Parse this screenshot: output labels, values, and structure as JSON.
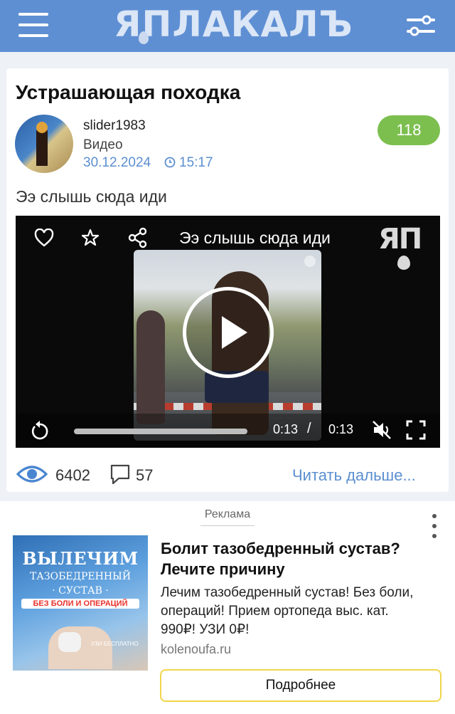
{
  "header": {
    "logo_text": "ЯПЛАКАЛЪ",
    "menu_icon": "hamburger-menu-icon",
    "settings_icon": "filter-sliders-icon",
    "background": "#5f8fd3"
  },
  "post": {
    "title": "Устрашающая походка",
    "author": "slider1983",
    "category": "Видео",
    "date": "30.12.2024",
    "time": "15:17",
    "rating": "118",
    "text": "Ээ слышь сюда иди",
    "video": {
      "title": "Ээ слышь сюда иди",
      "current_time": "0:13",
      "separator": "/",
      "total_time": "0:13",
      "watermark": "ЯП",
      "progress": 1.0
    },
    "views": "6402",
    "comments": "57",
    "read_more": "Читать дальше..."
  },
  "ad": {
    "label": "Реклама",
    "image_text": {
      "line1": "ВЫЛЕЧИМ",
      "line2": "ТАЗОБЕДРЕННЫЙ",
      "line3": "· СУСТАВ ·",
      "line4": "БЕЗ БОЛИ И ОПЕРАЦИЙ",
      "line5": "УЗИ БЕСПЛАТНО"
    },
    "title": "Болит тазобедренный сустав? Лечите причину",
    "description": "Лечим тазобедренный сустав! Без боли, операций! Прием ортопеда выс. кат. 990₽! УЗИ 0₽!",
    "domain": "kolenoufa.ru",
    "button": "Подробнее"
  },
  "colors": {
    "accent": "#5b8fd0",
    "rating_bg": "#7cbf4f",
    "ad_button_border": "#f2d64b"
  }
}
